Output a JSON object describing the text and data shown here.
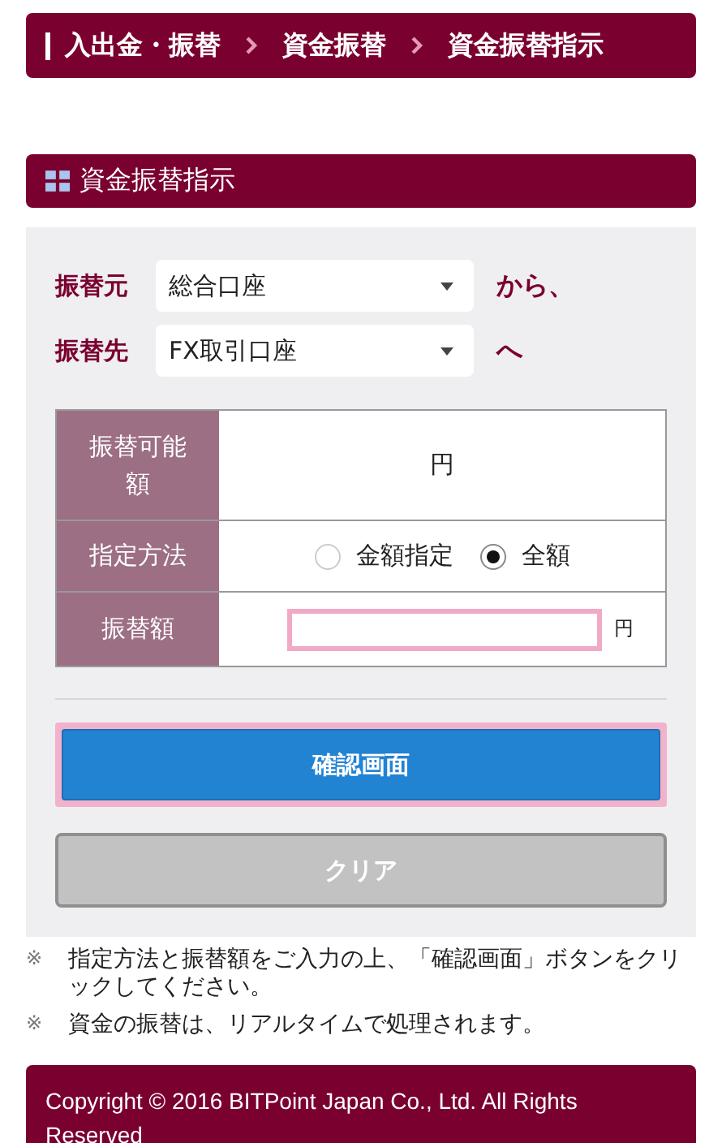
{
  "breadcrumb": [
    {
      "label": "入出金・振替"
    },
    {
      "label": "資金振替"
    },
    {
      "label": "資金振替指示"
    }
  ],
  "section": {
    "title": "資金振替指示"
  },
  "accounts": [
    {
      "label": "振替元",
      "value": "総合口座",
      "suffix": "から、"
    },
    {
      "label": "振替先",
      "value": "FX取引口座",
      "suffix": "へ"
    }
  ],
  "table": {
    "rows": [
      {
        "kind": "text",
        "label": "振替可能額",
        "value": "円"
      },
      {
        "kind": "radio",
        "label": "指定方法",
        "options": [
          {
            "label": "金額指定",
            "selected": false
          },
          {
            "label": "全額",
            "selected": true
          }
        ]
      },
      {
        "kind": "input",
        "label": "振替額",
        "unit": "円"
      }
    ]
  },
  "buttons": [
    {
      "kind": "primary",
      "label": "確認画面"
    },
    {
      "kind": "secondary",
      "label": "クリア"
    }
  ],
  "notes": [
    {
      "mark": "※",
      "text": "指定方法と振替額をご入力の上、「確認画面」ボタンをクリックしてください。"
    },
    {
      "mark": "※",
      "text": "資金の振替は、リアルタイムで処理されます。"
    }
  ],
  "footer": {
    "text": "Copyright © 2016 BITPoint Japan Co., Ltd. All Rights Reserved"
  }
}
